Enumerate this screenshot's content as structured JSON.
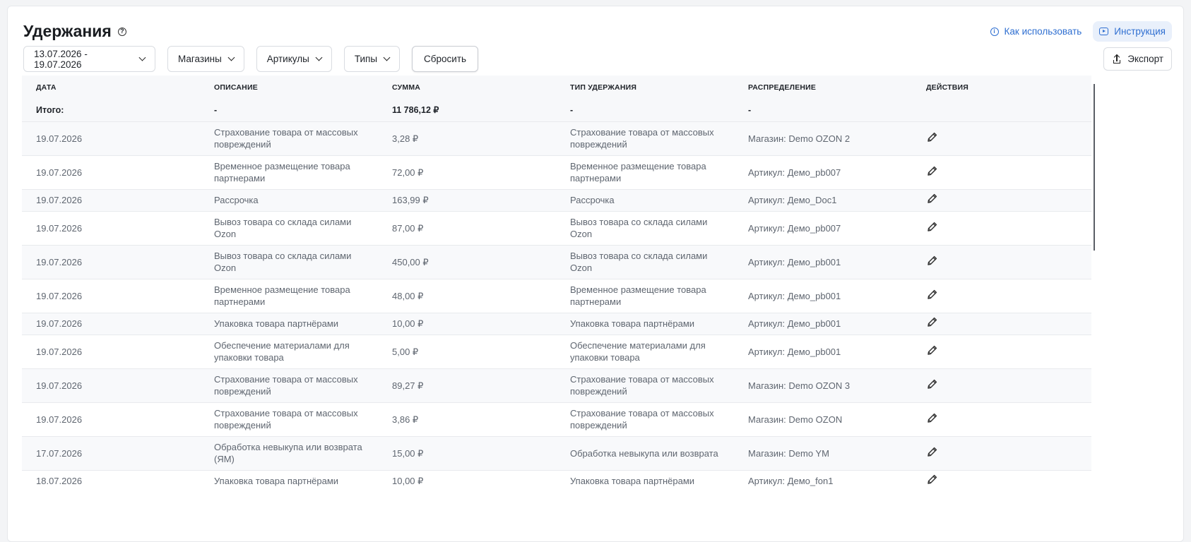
{
  "header": {
    "title": "Удержания",
    "how_to_use": "Как использовать",
    "instruction": "Инструкция",
    "export": "Экспорт"
  },
  "filters": {
    "date_range": "13.07.2026 - 19.07.2026",
    "stores": "Магазины",
    "articles": "Артикулы",
    "types": "Типы",
    "reset": "Сбросить"
  },
  "table": {
    "columns": [
      "Дата",
      "Описание",
      "Сумма",
      "Тип удержания",
      "Распределение",
      "Действия"
    ],
    "total": {
      "label": "Итого:",
      "description": "-",
      "amount": "11 786,12 ₽",
      "type": "-",
      "distribution": "-"
    },
    "rows": [
      {
        "date": "19.07.2026",
        "description": "Страхование товара от массовых повреждений",
        "amount": "3,28 ₽",
        "type": "Страхование товара от массовых повреждений",
        "distribution": "Магазин: Demo OZON 2"
      },
      {
        "date": "19.07.2026",
        "description": "Временное размещение товара партнерами",
        "amount": "72,00 ₽",
        "type": "Временное размещение товара партнерами",
        "distribution": "Артикул: Демо_pb007"
      },
      {
        "date": "19.07.2026",
        "description": "Рассрочка",
        "amount": "163,99 ₽",
        "type": "Рассрочка",
        "distribution": "Артикул: Демо_Doc1"
      },
      {
        "date": "19.07.2026",
        "description": "Вывоз товара со склада силами Ozon",
        "amount": "87,00 ₽",
        "type": "Вывоз товара со склада силами Ozon",
        "distribution": "Артикул: Демо_pb007"
      },
      {
        "date": "19.07.2026",
        "description": "Вывоз товара со склада силами Ozon",
        "amount": "450,00 ₽",
        "type": "Вывоз товара со склада силами Ozon",
        "distribution": "Артикул: Демо_pb001"
      },
      {
        "date": "19.07.2026",
        "description": "Временное размещение товара партнерами",
        "amount": "48,00 ₽",
        "type": "Временное размещение товара партнерами",
        "distribution": "Артикул: Демо_pb001"
      },
      {
        "date": "19.07.2026",
        "description": "Упаковка товара партнёрами",
        "amount": "10,00 ₽",
        "type": "Упаковка товара партнёрами",
        "distribution": "Артикул: Демо_pb001"
      },
      {
        "date": "19.07.2026",
        "description": "Обеспечение материалами для упаковки товара",
        "amount": "5,00 ₽",
        "type": "Обеспечение материалами для упаковки товара",
        "distribution": "Артикул: Демо_pb001"
      },
      {
        "date": "19.07.2026",
        "description": "Страхование товара от массовых повреждений",
        "amount": "89,27 ₽",
        "type": "Страхование товара от массовых повреждений",
        "distribution": "Магазин: Demo OZON 3"
      },
      {
        "date": "19.07.2026",
        "description": "Страхование товара от массовых повреждений",
        "amount": "3,86 ₽",
        "type": "Страхование товара от массовых повреждений",
        "distribution": "Магазин: Demo OZON"
      },
      {
        "date": "17.07.2026",
        "description": "Обработка невыкупа или возврата (ЯМ)",
        "amount": "15,00 ₽",
        "type": "Обработка невыкупа или возврата",
        "distribution": "Магазин: Demo YM"
      },
      {
        "date": "18.07.2026",
        "description": "Упаковка товара партнёрами",
        "amount": "10,00 ₽",
        "type": "Упаковка товара партнёрами",
        "distribution": "Артикул: Демо_fon1"
      }
    ]
  },
  "icons": {
    "help": "help-circle-icon",
    "info": "info-icon",
    "video": "video-icon",
    "chevron": "chevron-down-icon",
    "upload": "upload-icon",
    "edit": "pencil-icon"
  },
  "colors": {
    "accent": "#2f6fd1",
    "accent_bg": "#e9f0fb"
  }
}
